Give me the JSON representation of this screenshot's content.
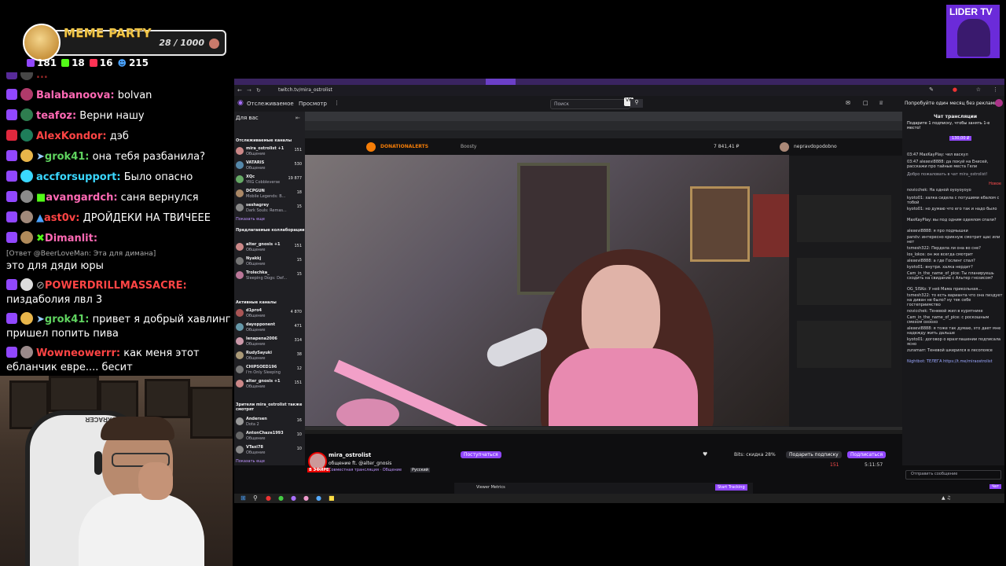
{
  "overlay": {
    "meme_title": "MEME PARTY",
    "meme_count": "28 / 1000",
    "stats": [
      {
        "icon": "twitch-icon",
        "value": "181",
        "color": "#9147ff"
      },
      {
        "icon": "kick-icon",
        "value": "18",
        "color": "#53fc18"
      },
      {
        "icon": "vk-live-icon",
        "value": "16",
        "color": "#ff3355"
      },
      {
        "icon": "viewers-icon",
        "value": "215",
        "color": "#4aa3ff"
      }
    ],
    "lider": "LIDER TV"
  },
  "chat": [
    {
      "nick": "Balabanoova:",
      "text": "bolvan",
      "color": "#ff69b4"
    },
    {
      "nick": "teafoz:",
      "text": "Верни нашу",
      "color": "#ff69b4"
    },
    {
      "nick": "AlexKondor:",
      "text": "дэб",
      "color": "#ff4444"
    },
    {
      "nick": "grok41:",
      "text": "она тебя разбанила?",
      "color": "#5fd35f"
    },
    {
      "nick": "accforsupport:",
      "text": "Было опасно",
      "color": "#3ad7ff"
    },
    {
      "nick": "avangardch:",
      "text": "саня вернулся",
      "color": "#ff69b4"
    },
    {
      "nick": "ast0v:",
      "text": "ДРОЙДЕКИ НА ТВИЧЕЕЕ",
      "color": "#ff4444"
    },
    {
      "nick": "Dimanlit:",
      "text": "",
      "color": "#ff69b4"
    },
    {
      "reply": "[Ответ @BeerLoveMan: Эта для димана]",
      "text": "это для дяди юры"
    },
    {
      "nick": "POWERDRILLMASSACRE:",
      "text": "",
      "color": "#ff4444"
    },
    {
      "text": "пиздаболия лвл 3"
    },
    {
      "nick": "grok41:",
      "text": "привет я добрый хавлинг",
      "color": "#5fd35f"
    },
    {
      "text": "пришел попить пива"
    },
    {
      "nick": "Wowneowerrr:",
      "text": "как меня этот",
      "color": "#ff4444"
    },
    {
      "text": "ебланчик евре.... бесит"
    }
  ],
  "browser": {
    "url": "twitch.tv/mira_ostrolist",
    "nav": [
      "Отслеживаемое",
      "Просмотр"
    ],
    "search_placeholder": "Поиск",
    "promo": "Попробуйте один месяц без рекламы",
    "sidebar_header": "Для вас",
    "sidebar_followed": "Отслеживаемые каналы",
    "channels": [
      {
        "name": "mira_ostrolist +1",
        "game": "Общение",
        "viewers": "151"
      },
      {
        "name": "VATARIS",
        "game": "Общение",
        "viewers": "530"
      },
      {
        "name": "XQc",
        "game": "YRG Cobbleverse",
        "viewers": "19 877"
      },
      {
        "name": "DCPGUN",
        "game": "Mobile Legends: B...",
        "viewers": "18"
      },
      {
        "name": "seshagrey",
        "game": "Dark Souls: Remas...",
        "viewers": "15"
      }
    ],
    "show_more": "Показать еще",
    "collab_header": "Предлагаемые коллаборации",
    "collab": [
      {
        "name": "alter_gnosis +1",
        "game": "Общение",
        "viewers": "151"
      },
      {
        "name": "Nyakkj",
        "game": "Общение",
        "viewers": "15"
      },
      {
        "name": "Trolechka_",
        "game": "Sleeping Dogs: Def...",
        "viewers": "15"
      }
    ],
    "active_header": "Активные каналы",
    "active": [
      {
        "name": "d1pro4",
        "game": "Общение",
        "viewers": "4 870"
      },
      {
        "name": "dayopponent",
        "game": "Общение",
        "viewers": "471"
      },
      {
        "name": "lenapena2006",
        "game": "Общение",
        "viewers": "314"
      },
      {
        "name": "RudySayuki",
        "game": "Общение",
        "viewers": "38"
      },
      {
        "name": "CHIPSOED196",
        "game": "I'm Only Sleeping",
        "viewers": "12"
      },
      {
        "name": "alter_gnosis +1",
        "game": "Общение",
        "viewers": "151"
      }
    ],
    "viewers_also": "Зрители mira_ostrolist также смотрят",
    "also": [
      {
        "name": "Andersen",
        "game": "Dota 2",
        "viewers": "16"
      },
      {
        "name": "AntonChaze1993",
        "game": "Общение",
        "viewers": "10"
      },
      {
        "name": "VTaxi78",
        "game": "Общение",
        "viewers": "10"
      }
    ],
    "streamer": "mira_ostrolist",
    "stream_title": "общение ft. @alter_gnosis",
    "category": "Совместная трансляция · Общение",
    "lang": "Русский",
    "follow_btn": "Подписаться",
    "gift_btn": "Подарить подписку",
    "bits_btn": "Bits: скидка 28%",
    "follow_link": "Поступчаться",
    "viewers": "151",
    "uptime": "5:11:57",
    "live": "В ЭФИРЕ",
    "chat_title": "Чат трансляции",
    "chat_input": "Отправить сообщение",
    "gift_promo": "Подарите 1 подписку, чтобы занять 1-е место!",
    "gift_price": "130,00 ₽",
    "welcome": "Добро пожаловать в чат mira_ostrolist!",
    "new_label": "Новое",
    "right_chat": [
      "03:47 MaxKayPlay: чел васкул",
      "03:47 alexevi8888: да покуй на Енисей, расскажи про тайные места Гели",
      "novicchek: На одной оуоуоуоуо",
      "kyoto01: халка сидела с потушими ебалом с тобой",
      "kyoto01: но думаю что его так и надо было",
      "MaxKayPlay: вы под одним одеялом спали?",
      "alexevi8888: я про подмышки",
      "parstv: интересно крикнуж смотрит щас или нет",
      "tsmesh322: Пердела ли она во сне?",
      "los_lokos: он же всегда смотрит",
      "alexevi8888: а где Гослинг спал?",
      "kyoto01: внутри. халка нердит?",
      "Cam_in_the_name_of_pice: Ты планируешь сходить на свидание с Альтер гнозисом?",
      "OG_SISKo: У неё Мама прикольная...",
      "tsmesh322: то есть варианта что она пиздует на диван не было? ну тек себе гостеприимство",
      "novicchek: Теневой жил в курятнике",
      "Cam_in_the_name_of_pice: с роскошным смехом охоохо",
      "alexevi8888: я тоже так думаю, это дает мне надежду жить дальше",
      "kyoto01: договор о вразглашении подписала ясно",
      "zuramarr: Теневой шкерился в лесопоясе",
      "Nightbot: ТЕЛЕГА https://t.me/miraostrolist"
    ],
    "viewer_metrics": "Viewer Metrics",
    "start_tracking": "Start Tracking",
    "da_label": "DONATIONALERTS",
    "boosty_label": "Boosty",
    "balance": "7 841,41 ₽",
    "da_user": "nepravdopodobno"
  }
}
